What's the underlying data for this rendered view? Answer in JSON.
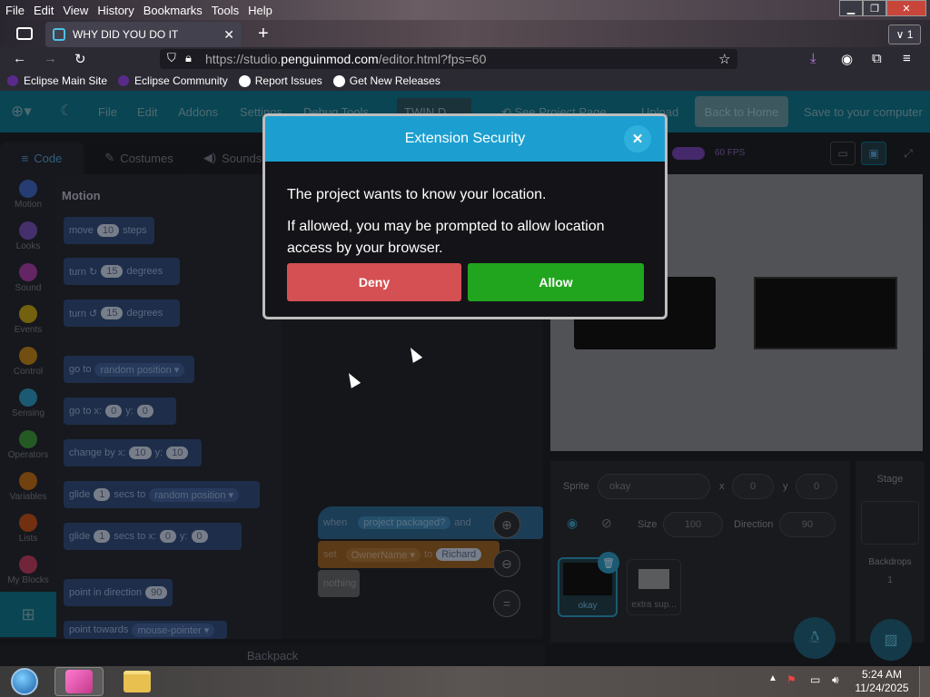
{
  "menubar": {
    "items": [
      "File",
      "Edit",
      "View",
      "History",
      "Bookmarks",
      "Tools",
      "Help"
    ]
  },
  "tab": {
    "title": "WHY DID YOU DO IT",
    "count": "∨ 1"
  },
  "url": {
    "prefix": "https://studio.",
    "domain": "penguinmod.com",
    "suffix": "/editor.html?fps=60"
  },
  "bookmarks": [
    "Eclipse Main Site",
    "Eclipse Community",
    "Report Issues",
    "Get New Releases"
  ],
  "app": {
    "menu": [
      "File",
      "Edit",
      "Addons",
      "Settings",
      "Debug Tools"
    ],
    "project_title": "TWIN D...",
    "see_project": "See Project Page",
    "upload": "Upload",
    "back_home": "Back to Home",
    "save": "Save to your computer",
    "fps": "60 FPS"
  },
  "editor_tabs": [
    "Code",
    "Costumes",
    "Sounds"
  ],
  "categories": [
    {
      "label": "Motion",
      "color": "#3a5fb0"
    },
    {
      "label": "Looks",
      "color": "#6a4aa8"
    },
    {
      "label": "Sound",
      "color": "#9a3a9a"
    },
    {
      "label": "Events",
      "color": "#b3951a"
    },
    {
      "label": "Control",
      "color": "#b07a1a"
    },
    {
      "label": "Sensing",
      "color": "#2a8ab0"
    },
    {
      "label": "Operators",
      "color": "#3a8a3a"
    },
    {
      "label": "Variables",
      "color": "#b0651a"
    },
    {
      "label": "Lists",
      "color": "#b04a1a"
    },
    {
      "label": "My Blocks",
      "color": "#b03a5a"
    }
  ],
  "palette": {
    "heading": "Motion",
    "blocks": [
      {
        "parts": [
          "move",
          "10",
          "steps"
        ]
      },
      {
        "parts": [
          "turn ↻",
          "15",
          "degrees"
        ]
      },
      {
        "parts": [
          "turn ↺",
          "15",
          "degrees"
        ]
      },
      {
        "parts": [
          "go to",
          "random position ▾"
        ]
      },
      {
        "parts": [
          "go to x:",
          "0",
          "y:",
          "0"
        ]
      },
      {
        "parts": [
          "change by x:",
          "10",
          "y:",
          "10"
        ]
      },
      {
        "parts": [
          "glide",
          "1",
          "secs to",
          "random position ▾"
        ]
      },
      {
        "parts": [
          "glide",
          "1",
          "secs to x:",
          "0",
          "y:",
          "0"
        ]
      },
      {
        "parts": [
          "point in direction",
          "90"
        ]
      },
      {
        "parts": [
          "point towards",
          "mouse-pointer ▾"
        ]
      }
    ]
  },
  "script": {
    "when": "when",
    "packaged": "project packaged?",
    "and": "and",
    "set": "set",
    "var": "OwnerName ▾",
    "to": "to",
    "value": "Richard",
    "nothing": "nothing",
    "backpack": "Backpack"
  },
  "sprite_info": {
    "label": "Sprite",
    "name": "okay",
    "x_label": "x",
    "x": "0",
    "y_label": "y",
    "y": "0",
    "size_label": "Size",
    "size": "100",
    "dir_label": "Direction",
    "dir": "90"
  },
  "sprites": [
    "okay",
    "extra sup..."
  ],
  "stage_pane": {
    "label": "Stage",
    "backdrops_label": "Backdrops",
    "backdrops": "1"
  },
  "modal": {
    "title": "Extension Security",
    "line1": "The project wants to know your location.",
    "line2": "If allowed, you may be prompted to allow location access by your browser.",
    "deny": "Deny",
    "allow": "Allow"
  },
  "clock": {
    "time": "5:24 AM",
    "date": "11/24/2025"
  }
}
